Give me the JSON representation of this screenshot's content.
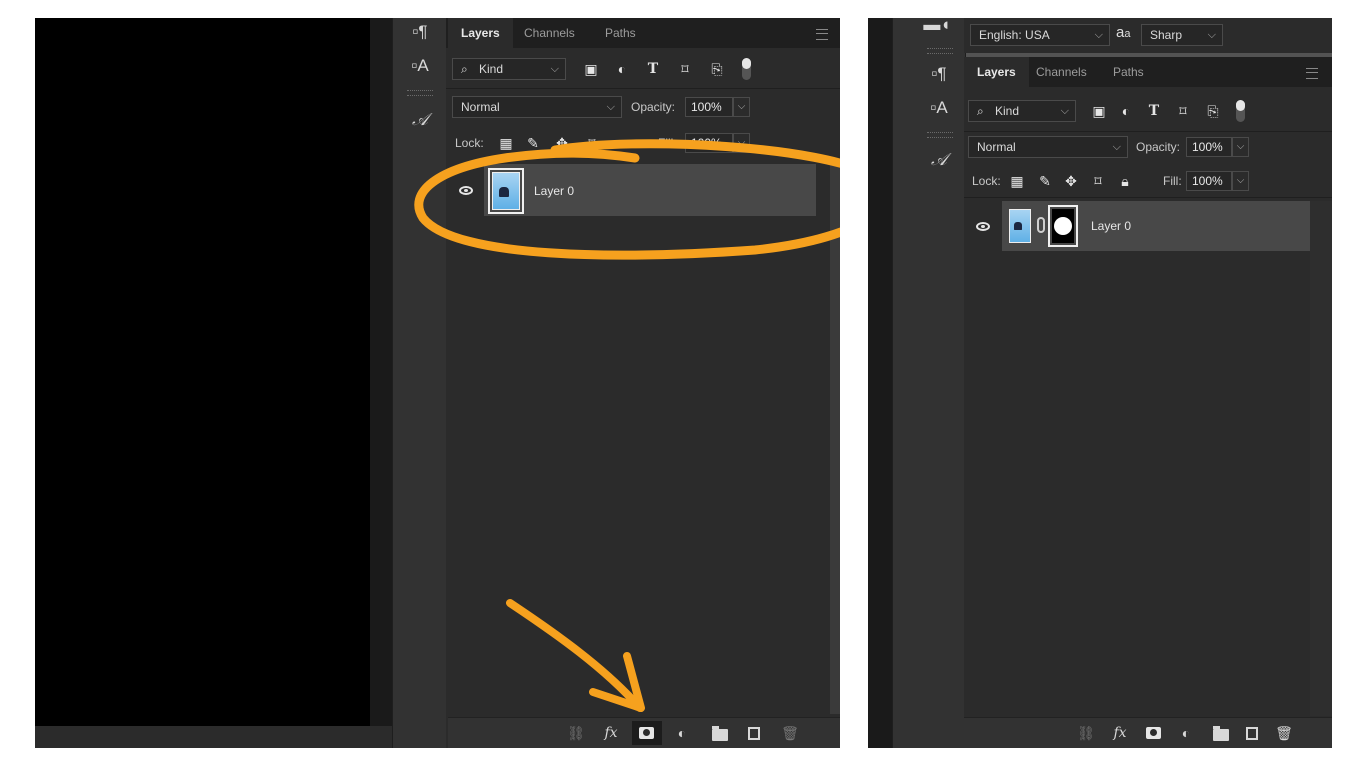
{
  "left_panel": {
    "tabs": [
      "Layers",
      "Channels",
      "Paths"
    ],
    "filter_kind": "Kind",
    "blend_mode": "Normal",
    "opacity_label": "Opacity:",
    "opacity_value": "100%",
    "lock_label": "Lock:",
    "fill_label": "Fill:",
    "fill_value": "100%",
    "layer_name": "Layer 0"
  },
  "right_panel": {
    "language": "English: USA",
    "aa_glyph": "a",
    "aa_glyph_sub": "a",
    "antialias": "Sharp",
    "tabs": [
      "Layers",
      "Channels",
      "Paths"
    ],
    "filter_kind": "Kind",
    "blend_mode": "Normal",
    "opacity_label": "Opacity:",
    "opacity_value": "100%",
    "lock_label": "Lock:",
    "fill_label": "Fill:",
    "fill_value": "100%",
    "layer_name": "Layer 0"
  },
  "annotation_colors": {
    "highlight": "#f6a11e"
  },
  "icons": {
    "filters": [
      "search-icon",
      "image-filter-icon",
      "adjustment-filter-icon",
      "type-filter-icon",
      "shape-filter-icon",
      "smart-object-filter-icon",
      "filter-toggle"
    ],
    "locks": [
      "lock-transparent-icon",
      "lock-paint-icon",
      "lock-move-icon",
      "lock-artboard-icon",
      "lock-all-icon"
    ],
    "bottom": [
      "link-icon",
      "fx-icon",
      "add-mask-icon",
      "adjustment-layer-icon",
      "group-folder-icon",
      "new-layer-icon",
      "trash-icon"
    ]
  }
}
